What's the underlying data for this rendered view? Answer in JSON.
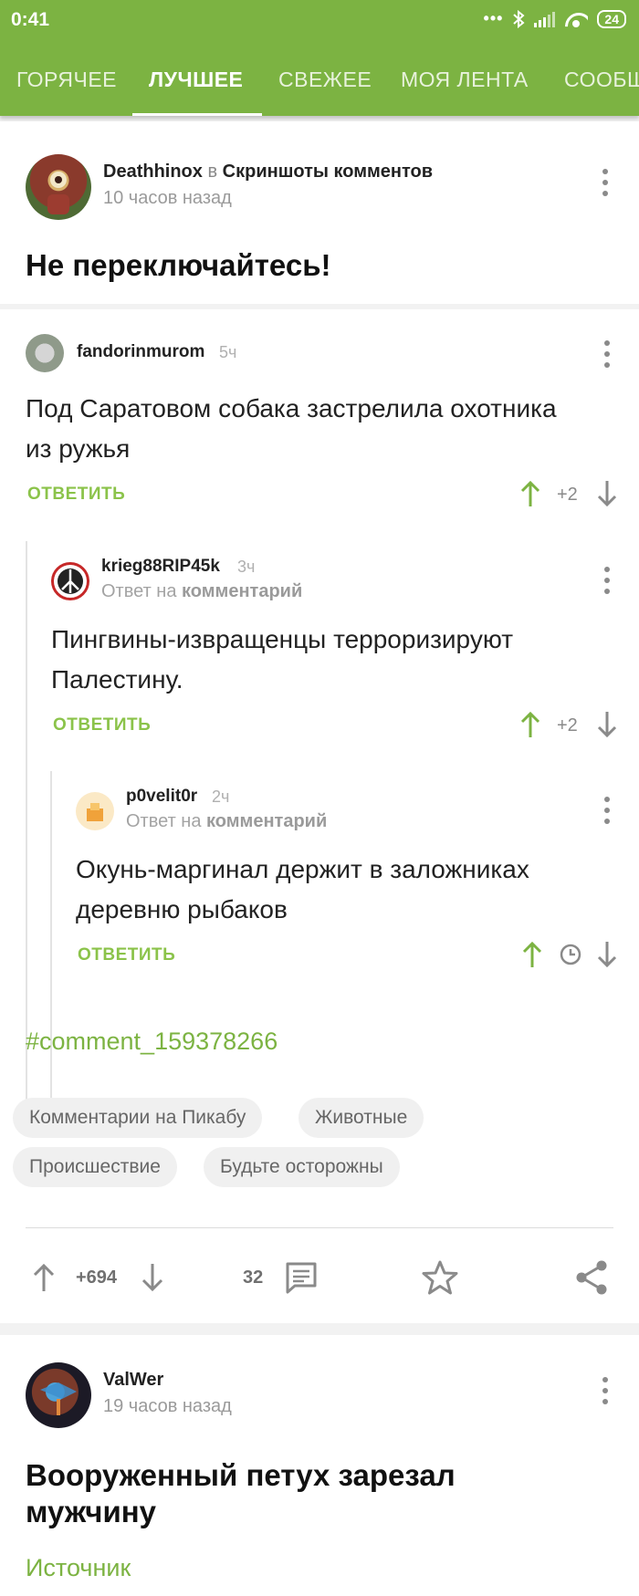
{
  "status_bar": {
    "time": "0:41",
    "battery": "24"
  },
  "tabs": [
    "ГОРЯЧЕЕ",
    "ЛУЧШЕЕ",
    "СВЕЖЕЕ",
    "МОЯ ЛЕНТА",
    "СООБЩ"
  ],
  "active_tab": "ЛУЧШЕЕ",
  "post1": {
    "author": "Deathhinox",
    "in_word": "в",
    "community": "Скриншоты комментов",
    "time": "10 часов назад",
    "title": "Не переключайтесь!",
    "comments": [
      {
        "user": "fandorinmurom",
        "time": "5ч",
        "text_line1": "Под Саратовом собака застрелила охотника",
        "text_line2": "из ружья",
        "answer": "ОТВЕТИТЬ",
        "score": "+2"
      },
      {
        "user": "krieg88RIP45k",
        "time": "3ч",
        "reply_prefix": "Ответ на",
        "reply_target": "комментарий",
        "text_line1": "Пингвины-извращенцы терроризируют",
        "text_line2": "Палестину.",
        "answer": "ОТВЕТИТЬ",
        "score": "+2"
      },
      {
        "user": "p0velit0r",
        "time": "2ч",
        "reply_prefix": "Ответ на",
        "reply_target": "комментарий",
        "text_line1": "Окунь-маргинал держит в заложниках",
        "text_line2": "деревню рыбаков",
        "answer": "ОТВЕТИТЬ"
      }
    ],
    "hashlink": "#comment_159378266",
    "tags": [
      "Комментарии на Пикабу",
      "Животные",
      "Происшествие",
      "Будьте осторожны"
    ],
    "rating": "+694",
    "comments_count": "32"
  },
  "post2": {
    "author": "ValWer",
    "time": "19 часов назад",
    "title_line1": "Вооруженный петух зарезал",
    "title_line2": "мужчину",
    "source": "Источник"
  },
  "colors": {
    "brand_green": "#7cb342",
    "link_green": "#8bc34a"
  },
  "icons": [
    "dots-icon",
    "bluetooth-icon",
    "signal-icon",
    "wifi-icon",
    "battery-icon",
    "kebab-menu-icon",
    "arrow-up-icon",
    "arrow-down-icon",
    "clock-icon",
    "comment-icon",
    "star-icon",
    "share-icon"
  ]
}
